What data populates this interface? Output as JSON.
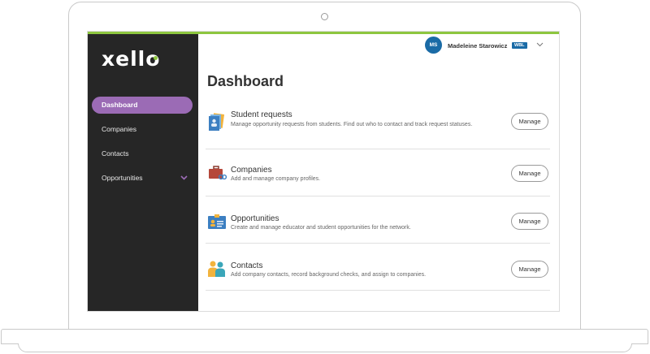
{
  "colors": {
    "brand_green": "#8dc63f",
    "sidebar_bg": "#262626",
    "active_purple": "#9b6bb5",
    "avatar_blue": "#1a6ba6",
    "badge_blue": "#1a6ba6"
  },
  "sidebar": {
    "logo": "xello",
    "items": [
      {
        "label": "Dashboard",
        "active": true
      },
      {
        "label": "Companies"
      },
      {
        "label": "Contacts"
      },
      {
        "label": "Opportunities",
        "icon": "chevron-down-icon"
      }
    ]
  },
  "header": {
    "avatar_initials": "MS",
    "user_name": "Madeleine Starowicz",
    "badge": "WBL"
  },
  "main": {
    "title": "Dashboard",
    "rows": [
      {
        "title": "Student requests",
        "desc": "Manage opportunity requests from students. Find out who to contact and track request statuses.",
        "button": "Manage",
        "icon": "student-requests-icon"
      },
      {
        "title": "Companies",
        "desc": "Add and manage company profiles.",
        "button": "Manage",
        "icon": "briefcase-icon"
      },
      {
        "title": "Opportunities",
        "desc": "Create and manage educator and student opportunities for the network.",
        "button": "Manage",
        "icon": "id-card-icon"
      },
      {
        "title": "Contacts",
        "desc": "Add company contacts, record background checks, and assign to companies.",
        "button": "Manage",
        "icon": "people-icon"
      }
    ]
  }
}
